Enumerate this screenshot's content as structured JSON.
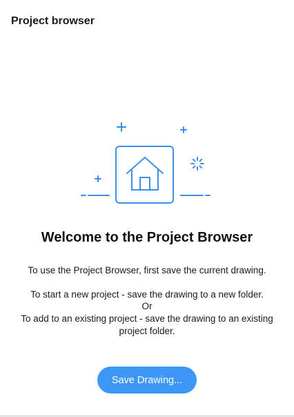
{
  "panel": {
    "title": "Project browser"
  },
  "illustration": {
    "icon": "home-icon",
    "decorations": [
      "plus-icon",
      "plus-icon",
      "plus-icon",
      "loading-spinner-icon"
    ],
    "accent_color": "#3d8fe8"
  },
  "welcome": {
    "title": "Welcome to the Project Browser",
    "line1": "To use the Project Browser, first save the current drawing.",
    "line2": "To start a new project - save the drawing to a new folder.",
    "or": "Or",
    "line3": "To add to an existing project - save the drawing to an existing project folder."
  },
  "actions": {
    "save_label": "Save Drawing...",
    "button_color": "#3d97f5"
  }
}
